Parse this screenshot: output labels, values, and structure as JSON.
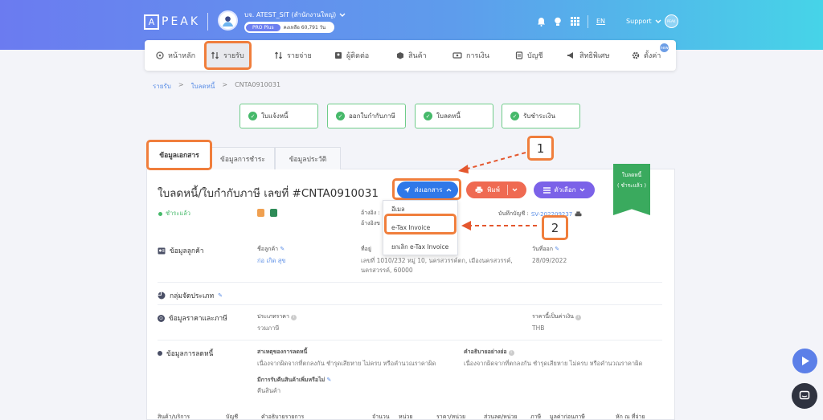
{
  "header": {
    "logo_text": "PEAK",
    "logo_mark": "A",
    "company_name": "บจ. ATEST_SIT (สำนักงานใหญ่)",
    "plan_label": "PRO Plus",
    "plan_remaining": "คงเหลือ 60,791 วัน",
    "language": "EN",
    "support_label": "Support",
    "peak_badge": "PEAK"
  },
  "nav": {
    "items": [
      {
        "label": "หน้าหลัก",
        "icon": "home-icon"
      },
      {
        "label": "รายรับ",
        "icon": "income-icon"
      },
      {
        "label": "รายจ่าย",
        "icon": "expense-icon"
      },
      {
        "label": "ผู้ติดต่อ",
        "icon": "contacts-icon"
      },
      {
        "label": "สินค้า",
        "icon": "product-icon"
      },
      {
        "label": "การเงิน",
        "icon": "finance-icon"
      },
      {
        "label": "บัญชี",
        "icon": "accounting-icon"
      },
      {
        "label": "สิทธิพิเศษ",
        "icon": "megaphone-icon"
      },
      {
        "label": "ตั้งค่า",
        "icon": "gear-icon"
      }
    ],
    "settings_badge": "new"
  },
  "breadcrumb": {
    "level1": "รายรับ",
    "level2": "ใบลดหนี้",
    "current": "CNTA0910031",
    "sep": ">"
  },
  "workflow": {
    "steps": [
      "ใบแจ้งหนี้",
      "ออกใบกำกับภาษี",
      "ใบลดหนี้",
      "รับชำระเงิน"
    ]
  },
  "tabs": [
    "ข้อมูลเอกสาร",
    "ข้อมูลการชำระ",
    "ข้อมูลประวัติ"
  ],
  "document": {
    "title": "ใบลดหนี้/ใบกำกับภาษี เลขที่ #CNTA0910031",
    "status": "ชำระแล้ว",
    "ribbon_line1": "ใบลดหนี้",
    "ribbon_line2": "( ชำระแล้ว )",
    "ref_label1": "อ้างอิง :",
    "ref_label2": "อ้างอิงข",
    "journal_label": "บันทึกบัญชี :",
    "journal_value": "SV-202209237"
  },
  "actions": {
    "send_label": "ส่งเอกสาร",
    "print_label": "พิมพ์",
    "options_label": "ตัวเลือก"
  },
  "send_menu": {
    "items": [
      "อีเมล",
      "e-Tax Invoice",
      "ยกเลิก e-Tax Invoice"
    ]
  },
  "customer": {
    "section_label": "ข้อมูลลูกค้า",
    "name_label": "ชื่อลูกค้า",
    "name_value": "ก่อ เกิด สุข",
    "address_label": "ที่อยู่",
    "address_line1": "เลขที่ 1010/232 หมู่ 10, นครสวรรค์ตก, เมืองนครสวรรค์,",
    "address_line2": "นครสวรรค์, 60000",
    "date_label": "วันที่ออก",
    "date_value": "28/09/2022"
  },
  "group_section": {
    "label": "กลุ่มจัดประเภท"
  },
  "price_section": {
    "label": "ข้อมูลราคาและภาษี",
    "price_type_label": "ประเภทราคา",
    "price_type_value": "รวมภาษี",
    "currency_label": "ราคานี้เป็นค่าเงิน",
    "currency_value": "THB"
  },
  "credit_section": {
    "label": "ข้อมูลการลดหนี้",
    "reason_label": "สาเหตุของการลดหนี้",
    "reason_value": "เนื่องจากผิดจากที่ตกลงกัน ชำรุดเสียหาย ไม่ครบ หรือคำนวณราคาผิด",
    "desc_label": "คำอธิบายอย่างย่อ",
    "desc_value": "เนื่องจากผิดจากที่ตกลงกัน ชำรุดเสียหาย ไม่ครบ หรือคำนวณราคาผิด",
    "return_label": "มีการรับคืนสินค้าเพิ่มหรือไม่",
    "return_value": "คืนสินค้า"
  },
  "table_headers": [
    "สินค้า/บริการ",
    "บัญชี",
    "คำอธิบายรายการ",
    "จำนวน",
    "หน่วย",
    "ราคา/หน่วย",
    "ส่วนลด/หน่วย",
    "ภาษี",
    "มูลค่าก่อนภาษี",
    "หัก ณ ที่จ่าย"
  ],
  "annotations": {
    "callout1": "1",
    "callout2": "2"
  },
  "colors": {
    "accent": "#f07e3c",
    "primary": "#2f78e8",
    "success": "#46b96a",
    "print": "#ef6a52",
    "options": "#7b62e8"
  }
}
